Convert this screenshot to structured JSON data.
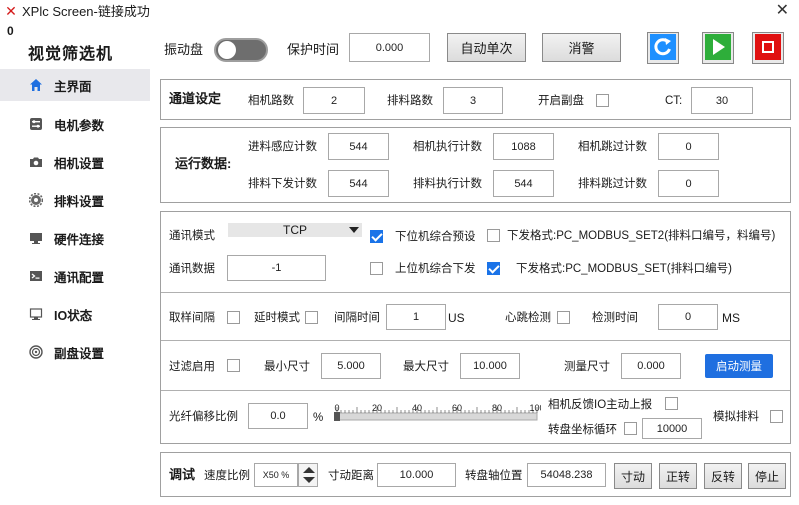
{
  "window": {
    "title": "XPlc Screen-链接成功",
    "close": "✕",
    "corner_value": "0"
  },
  "app_name": "视觉筛选机",
  "sidebar": {
    "items": [
      {
        "label": "主界面",
        "icon": "home-icon",
        "active": true
      },
      {
        "label": "电机参数",
        "icon": "sliders-icon"
      },
      {
        "label": "相机设置",
        "icon": "camera-icon"
      },
      {
        "label": "排料设置",
        "icon": "gear-icon"
      },
      {
        "label": "硬件连接",
        "icon": "monitor-icon"
      },
      {
        "label": "通讯配置",
        "icon": "terminal-icon"
      },
      {
        "label": "IO状态",
        "icon": "io-monitor-icon"
      },
      {
        "label": "副盘设置",
        "icon": "disc-icon"
      }
    ]
  },
  "topbar": {
    "vibration_label": "振动盘",
    "vibration_on": false,
    "protect_time_label": "保护时间",
    "protect_time_value": "0.000",
    "auto_single_label": "自动单次",
    "clear_alarm_label": "消警",
    "refresh_icon": "refresh-icon",
    "start_icon": "play-icon",
    "stop_icon": "stop-icon",
    "colors": {
      "refresh": "#1e90ff",
      "start": "#2eae3a",
      "stop": "#e01010"
    }
  },
  "channel": {
    "title": "通道设定",
    "camera_count_label": "相机路数",
    "camera_count": "2",
    "discharge_count_label": "排料路数",
    "discharge_count": "3",
    "sub_disc_label": "开启副盘",
    "sub_disc_checked": false,
    "ct_label": "CT:",
    "ct_value": "30"
  },
  "running": {
    "title": "运行数据:",
    "feed_sense_label": "进料感应计数",
    "feed_sense": "544",
    "camera_exec_label": "相机执行计数",
    "camera_exec": "1088",
    "camera_skip_label": "相机跳过计数",
    "camera_skip": "0",
    "discharge_issue_label": "排料下发计数",
    "discharge_issue": "544",
    "discharge_exec_label": "排料执行计数",
    "discharge_exec": "544",
    "discharge_skip_label": "排料跳过计数",
    "discharge_skip": "0"
  },
  "comm": {
    "mode_label": "通讯模式",
    "mode_value": "TCP",
    "lower_preset_label": "下位机综合预设",
    "lower_preset_checked": true,
    "format2_label": "下发格式:PC_MODBUS_SET2(排料口编号，料编号)",
    "format2_checked": false,
    "data_label": "通讯数据",
    "data_value": "-1",
    "upper_issue_label": "上位机综合下发",
    "upper_issue_checked": false,
    "format1_label": "下发格式:PC_MODBUS_SET(排料口编号)",
    "format1_checked": true
  },
  "sampling": {
    "interval_label": "取样间隔",
    "interval_checked": false,
    "delay_mode_label": "延时模式",
    "delay_mode_checked": false,
    "gap_time_label": "间隔时间",
    "gap_time": "1",
    "gap_unit": "US",
    "heartbeat_label": "心跳检测",
    "heartbeat_checked": false,
    "check_time_label": "检测时间",
    "check_time": "0",
    "check_unit": "MS"
  },
  "filter": {
    "enable_label": "过滤启用",
    "enable_checked": false,
    "min_size_label": "最小尺寸",
    "min_size": "5.000",
    "max_size_label": "最大尺寸",
    "max_size": "10.000",
    "measure_label": "测量尺寸",
    "measure_value": "0.000",
    "start_measure_label": "启动测量"
  },
  "fiber": {
    "offset_label": "光纤偏移比例",
    "offset_value": "0.0",
    "percent": "%",
    "ruler_ticks": [
      "0",
      "20",
      "40",
      "60",
      "80",
      "100"
    ],
    "camera_feedback_label": "相机反馈IO主动上报",
    "camera_feedback_checked": false,
    "coord_loop_label": "转盘坐标循环",
    "coord_loop_checked": false,
    "coord_loop_value": "10000",
    "sim_discharge_label": "模拟排料",
    "sim_discharge_checked": false
  },
  "debug": {
    "title": "调试",
    "speed_label": "速度比例",
    "speed_value": "X50 %",
    "jog_dist_label": "寸动距离",
    "jog_dist": "10.000",
    "axis_pos_label": "转盘轴位置",
    "axis_pos": "54048.238",
    "jog_button": "寸动",
    "forward_button": "正转",
    "reverse_button": "反转",
    "stop_button": "停止"
  }
}
